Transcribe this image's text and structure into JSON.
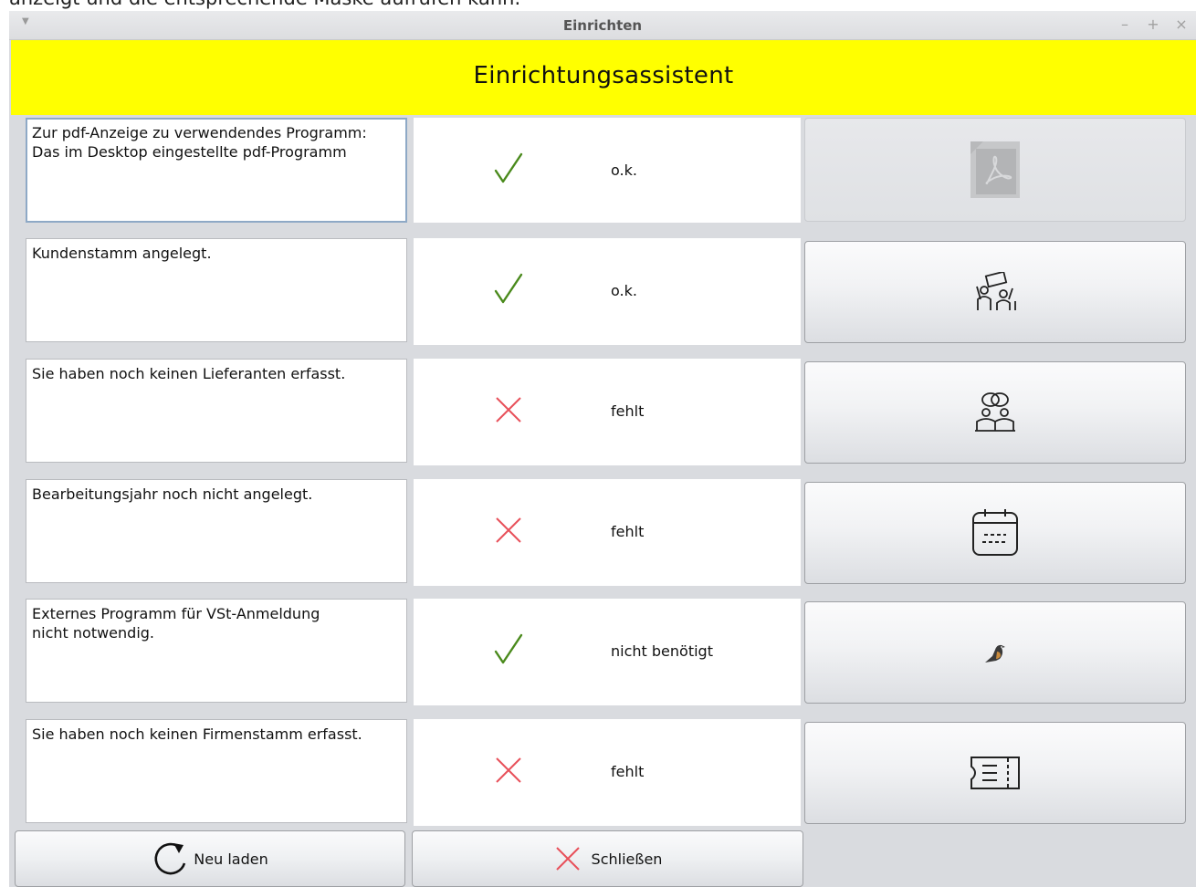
{
  "page_snippet": "anzeigt und die entsprechende Maske aufrufen kann.",
  "window": {
    "title": "Einrichten",
    "controls": {
      "minimize": "–",
      "maximize": "+",
      "close": "×"
    }
  },
  "banner": {
    "text": "Einrichtungsassistent",
    "color": "#ffff00"
  },
  "rows": [
    {
      "description": "Zur pdf-Anzeige zu verwendendes Programm:\nDas im Desktop eingestellte pdf-Programm",
      "status_icon": "check-icon",
      "status_text": "o.k.",
      "button_icon": "pdf-document-icon",
      "button_enabled": false
    },
    {
      "description": "Kundenstamm angelegt.",
      "status_icon": "check-icon",
      "status_text": "o.k.",
      "button_icon": "customers-icon",
      "button_enabled": true
    },
    {
      "description": "Sie haben noch keinen Lieferanten erfasst.",
      "status_icon": "cross-icon",
      "status_text": "fehlt",
      "button_icon": "suppliers-icon",
      "button_enabled": true
    },
    {
      "description": "Bearbeitungsjahr noch nicht angelegt.",
      "status_icon": "cross-icon",
      "status_text": "fehlt",
      "button_icon": "calendar-icon",
      "button_enabled": true
    },
    {
      "description": "Externes Programm für VSt-Anmeldung\nnicht notwendig.",
      "status_icon": "check-icon",
      "status_text": "nicht benötigt",
      "button_icon": "bird-icon",
      "button_enabled": true
    },
    {
      "description": "Sie haben noch keinen Firmenstamm erfasst.",
      "status_icon": "cross-icon",
      "status_text": "fehlt",
      "button_icon": "company-card-icon",
      "button_enabled": true
    }
  ],
  "footer": {
    "reload_label": "Neu laden",
    "close_label": "Schließen"
  },
  "colors": {
    "check": "#4a8a1c",
    "cross": "#e8505a",
    "banner": "#ffff00"
  }
}
